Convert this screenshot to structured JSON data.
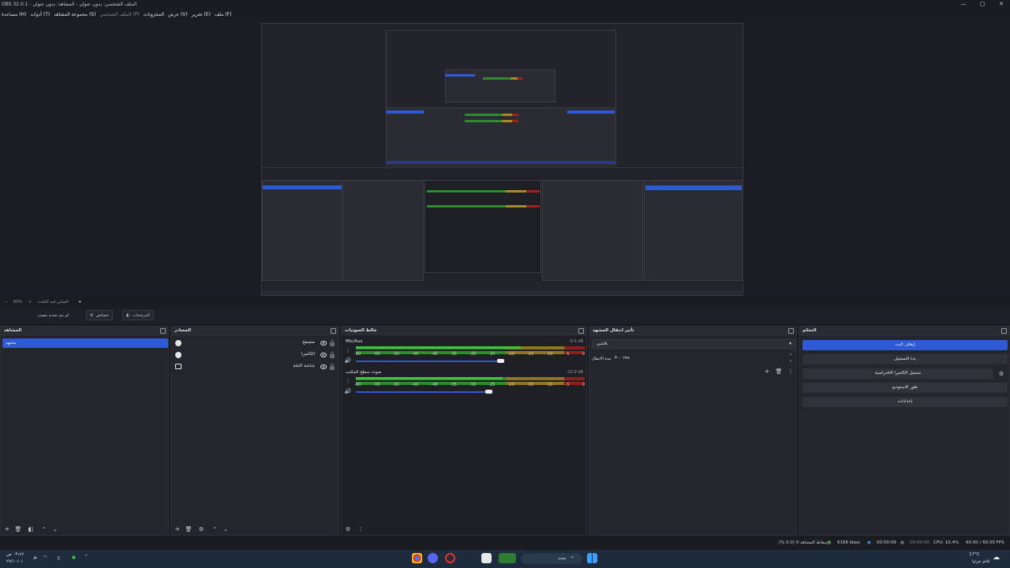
{
  "window": {
    "title": "OBS 32.0.1 - الملف الشخصي: بدون عنوان - المشاهد: بدون عنوان",
    "min_glyph": "—",
    "max_glyph": "▢",
    "close_glyph": "✕"
  },
  "menu": [
    {
      "label": "ملف (F)"
    },
    {
      "label": "تحرير (E)"
    },
    {
      "label": "عرض (V)"
    },
    {
      "label": "المحزونات"
    },
    {
      "label": "الملف الشخصي (P)",
      "dim": true
    },
    {
      "label": "مجموعة المشاهد (S)"
    },
    {
      "label": "أدوات (T)"
    },
    {
      "label": "مساعدة (H)"
    }
  ],
  "zoom": {
    "value": "63%",
    "fit_label": "القياس لحد النافذة"
  },
  "strip": {
    "no_source_label": "لم يتم تحديد مصدر",
    "properties_label": "خصائص",
    "filters_label": "المرشحات"
  },
  "scenes": {
    "title": "المشاهد",
    "items": [
      "مشهد"
    ]
  },
  "sources": {
    "title": "المصادر",
    "items": [
      {
        "name": "متصفح",
        "icon": "browser-icon"
      },
      {
        "name": "الكاميرا",
        "icon": "camera-icon"
      },
      {
        "name": "شاشة كاملة",
        "icon": "monitor-icon"
      }
    ]
  },
  "mixer": {
    "title": "خالط الصوتيات",
    "scale": [
      "-60",
      "-55",
      "-50",
      "-45",
      "-40",
      "-35",
      "-30",
      "-25",
      "-20",
      "-15",
      "-10",
      "-5",
      "0"
    ],
    "channels": [
      {
        "name": "Mic/Aux",
        "db": "-9.5 dB",
        "level": 0.72,
        "volume": 0.63
      },
      {
        "name": "صوت سطح المكتب",
        "db": "-10.9 dB",
        "level": 0.64,
        "volume": 0.58
      }
    ]
  },
  "transitions": {
    "title": "تأثير انتقال المشهد",
    "selected": "تلاشي",
    "duration_label": "مدة الانتقال",
    "duration_value": "٣٠٠ ms"
  },
  "controls": {
    "title": "التحكم",
    "buttons": [
      {
        "label": "إيقاف البث",
        "primary": true
      },
      {
        "label": "بدء التسجيل"
      },
      {
        "label": "تشغيل الكاميرا الافتراضية"
      },
      {
        "label": "طور الاستوديو"
      },
      {
        "label": "إعدادات"
      }
    ]
  },
  "status": {
    "fps": "60.00 / 60.00 FPS",
    "cpu": "CPU: 10.4%",
    "rec_time": "00:00:00",
    "stream_time": "00:00:09",
    "bitrate": "6166 kbps",
    "dropped": "إسقاط المشاهد 0 (0.0 %)"
  },
  "taskbar": {
    "time": "٠٣:٤٧ ص",
    "date": "٢٧/١٠/٠١",
    "search": "بحث",
    "weather_temp": "17°C",
    "weather_desc": "غائم جزئيا",
    "lang": "ع"
  },
  "colors": {
    "accent": "#2f5ad6",
    "background": "#1b1c22",
    "dock": "#25262d",
    "meter_green": "#2e8a2e",
    "meter_yellow": "#8f7520",
    "meter_red": "#8f1f1f"
  }
}
